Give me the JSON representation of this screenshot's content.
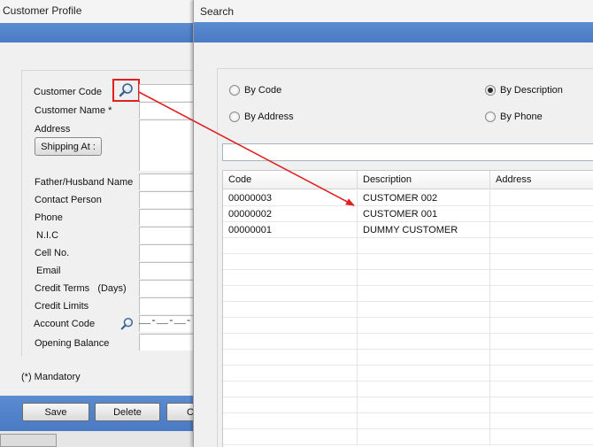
{
  "customer_profile": {
    "title": "Customer Profile",
    "fields": [
      {
        "label": "Customer Code",
        "required": false
      },
      {
        "label": "Customer Name",
        "required": true,
        "marker": "*"
      },
      {
        "label": "Address"
      },
      {
        "label": "Father/Husband Name"
      },
      {
        "label": "Contact Person"
      },
      {
        "label": "Phone"
      },
      {
        "label": "N.I.C"
      },
      {
        "label": "Cell No."
      },
      {
        "label": "Email"
      },
      {
        "label": "Credit Terms",
        "suffix": "(Days)"
      },
      {
        "label": "Credit Limits"
      },
      {
        "label": "Account Code",
        "mask": "__-__-__-"
      },
      {
        "label": "Opening Balance"
      }
    ],
    "shipping_button": "Shipping At :",
    "mandatory_note": "(*) Mandatory",
    "buttons": {
      "save": "Save",
      "delete": "Delete",
      "close_partial": "C"
    },
    "icons": {
      "customer_code_search": "magnifier-icon",
      "account_code_search": "magnifier-icon"
    }
  },
  "search": {
    "title": "Search",
    "options": [
      {
        "label": "By Code",
        "checked": false
      },
      {
        "label": "By Description",
        "checked": true
      },
      {
        "label": "By Address",
        "checked": false
      },
      {
        "label": "By Phone",
        "checked": false
      }
    ],
    "query": "",
    "columns": [
      "Code",
      "Description",
      "Address"
    ],
    "rows": [
      {
        "code": "00000003",
        "description": "CUSTOMER 002",
        "address": ""
      },
      {
        "code": "00000002",
        "description": "CUSTOMER 001",
        "address": ""
      },
      {
        "code": "00000001",
        "description": "DUMMY CUSTOMER",
        "address": ""
      }
    ]
  },
  "colors": {
    "header_blue": "#4a7ac4",
    "annotation_red": "#e02020",
    "window_bg": "#f0f0f0"
  }
}
